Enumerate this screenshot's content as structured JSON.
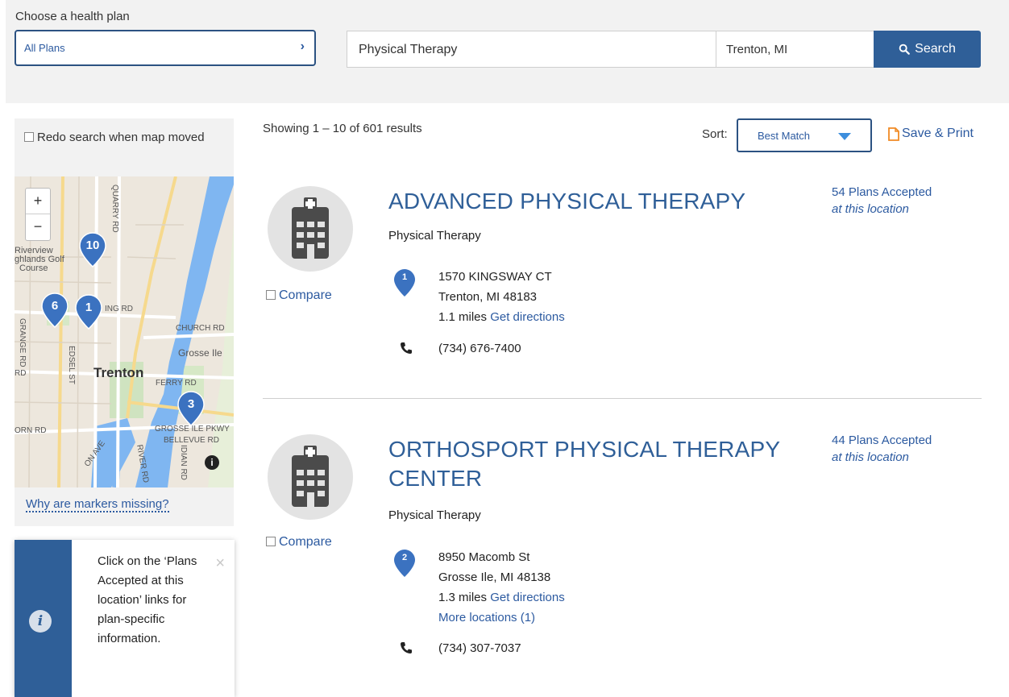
{
  "search": {
    "plan_label": "Choose a health plan",
    "plan_value": "All Plans",
    "specialty": "Physical Therapy",
    "location": "Trenton, MI",
    "search_button": "Search"
  },
  "map": {
    "redo_label": "Redo search when map moved",
    "zoom_in": "+",
    "zoom_out": "−",
    "markers": [
      "10",
      "6",
      "1",
      "3"
    ],
    "labels": {
      "quarry": "QUARRY RD",
      "riverview": "Riverview",
      "highlands": "ghlands Golf",
      "course": "Course",
      "king": "ING RD",
      "church": "CHURCH RD",
      "grange": "GRANGE RD",
      "edsel": "EDSEL ST",
      "grosse_ile": "Grosse Ile",
      "trenton": "Trenton",
      "ferry": "FERRY RD",
      "rd": "RD",
      "orn": "ORN RD",
      "grosse_pkwy": "GROSSE ILE PKWY",
      "bellevue": "BELLEVUE RD",
      "river": "RIVER RD",
      "meridian": "IDIAN RD",
      "on": "ON AVE"
    },
    "info": "i",
    "why_link": "Why are markers missing?"
  },
  "tip": {
    "icon": "i",
    "text": "Click on the ‘Plans Accepted at this location’ links for plan-specific information.",
    "close": "×"
  },
  "results_header": {
    "showing": "Showing 1 – 10 of 601 results",
    "sort_label": "Sort:",
    "sort_value": "Best Match",
    "save_print": "Save & Print"
  },
  "results": [
    {
      "name": "ADVANCED PHYSICAL THERAPY",
      "specialty": "Physical Therapy",
      "compare": "Compare",
      "pin": "1",
      "address1": "1570 KINGSWAY CT",
      "address2": "Trenton, MI 48183",
      "distance": "1.1 miles",
      "directions": "Get directions",
      "phone": "(734) 676-7400",
      "plans": "54 Plans Accepted",
      "plans_sub": "at this location"
    },
    {
      "name": "ORTHOSPORT PHYSICAL THERAPY CENTER",
      "specialty": "Physical Therapy",
      "compare": "Compare",
      "pin": "2",
      "address1": "8950 Macomb St",
      "address2": "Grosse Ile, MI 48138",
      "distance": "1.3 miles",
      "directions": "Get directions",
      "more_locations": "More locations (1)",
      "phone": "(734) 307-7037",
      "plans": "44 Plans Accepted",
      "plans_sub": "at this location"
    }
  ],
  "colors": {
    "brand": "#2f5f98",
    "link": "#2c5aa0",
    "marker": "#3b72c0",
    "pdf": "#f08a24"
  },
  "icons": [
    "chevron-right-icon",
    "search-icon",
    "checkbox-icon",
    "map-pin-icon",
    "info-icon",
    "close-icon",
    "hospital-building-icon",
    "phone-icon",
    "document-icon",
    "caret-down-icon"
  ]
}
